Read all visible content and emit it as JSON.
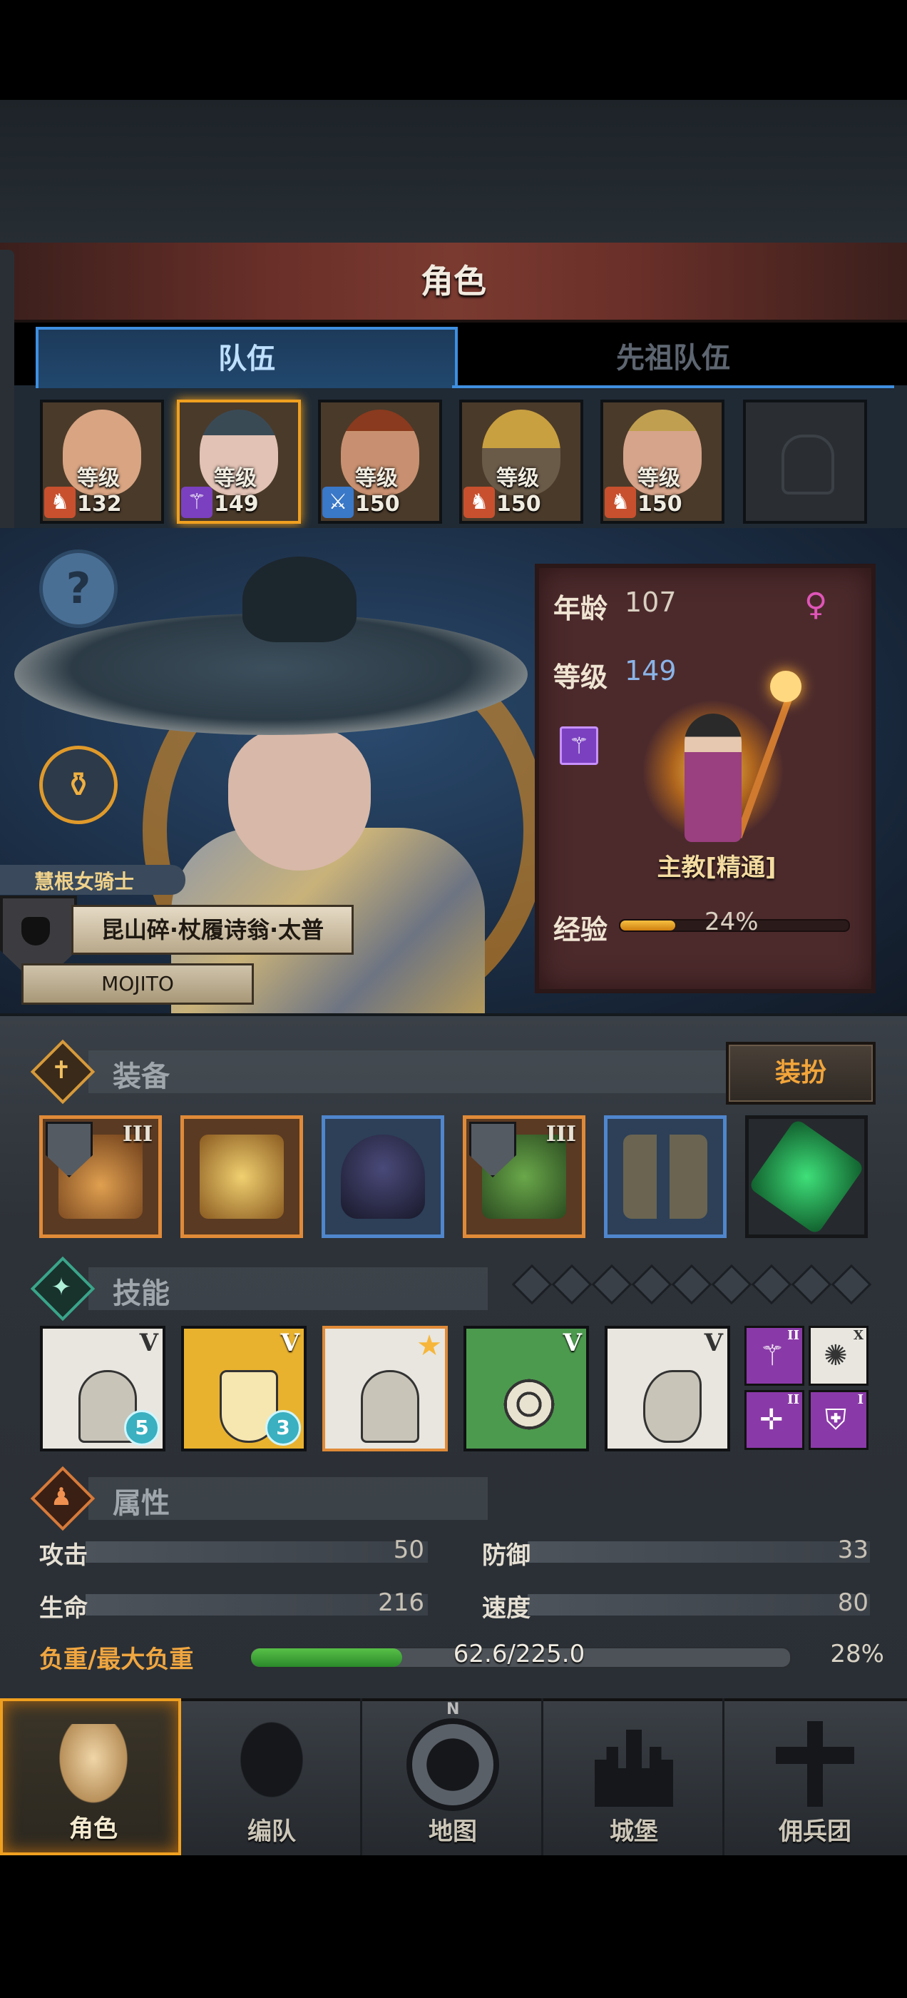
{
  "header": {
    "title": "角色"
  },
  "tabs": [
    {
      "label": "队伍",
      "active": true
    },
    {
      "label": "先祖队伍",
      "active": false
    }
  ],
  "roster": [
    {
      "level_text": "等级132",
      "class_icon": "warrior-red-icon",
      "selected": false
    },
    {
      "level_text": "等级149",
      "class_icon": "staff-purple-icon",
      "selected": true
    },
    {
      "level_text": "等级150",
      "class_icon": "sword-blue-icon",
      "selected": false
    },
    {
      "level_text": "等级150",
      "class_icon": "warrior-red-icon",
      "selected": false
    },
    {
      "level_text": "等级150",
      "class_icon": "warrior-red-icon",
      "selected": false
    },
    {
      "level_text": "",
      "class_icon": "empty-slot-icon",
      "selected": false
    }
  ],
  "hero": {
    "order": "慧根女骑士",
    "title": "昆山碎·杖履诗翁·太普",
    "player": "MOJITO"
  },
  "info": {
    "age_label": "年龄",
    "age_value": "107",
    "level_label": "等级",
    "level_value": "149",
    "class_name": "主教[精通]",
    "exp_label": "经验",
    "exp_percent_text": "24%",
    "exp_fraction": 0.24,
    "gender_icon": "female-icon",
    "gender_glyph": "♀",
    "age_color": "#d9cfc0",
    "level_color": "#8ab4e8"
  },
  "equipment": {
    "title": "装备",
    "dress_button": "装扮",
    "slots": [
      {
        "tier": "III",
        "frame": "orange",
        "shield": true
      },
      {
        "tier": "",
        "frame": "orange",
        "shield": false
      },
      {
        "tier": "",
        "frame": "blue",
        "shield": false
      },
      {
        "tier": "III",
        "frame": "orange",
        "shield": true
      },
      {
        "tier": "",
        "frame": "blue",
        "shield": false
      },
      {
        "tier": "",
        "frame": "dark",
        "shield": false
      }
    ]
  },
  "skills": {
    "title": "技能",
    "slot_dots": 9,
    "items": [
      {
        "rank": "V",
        "badge": "5",
        "bg": "#e8e6df"
      },
      {
        "rank": "V",
        "badge": "3",
        "bg": "#e9b22e"
      },
      {
        "rank": "",
        "badge": "",
        "bg": "#e8e6df",
        "starred": true
      },
      {
        "rank": "V",
        "badge": "",
        "bg": "#4c9a4e"
      },
      {
        "rank": "V",
        "badge": "",
        "bg": "#e8e6df"
      }
    ],
    "passives": [
      {
        "tier": "II",
        "bg": "#8a3aa8"
      },
      {
        "tier": "X",
        "bg": "#e8e6df"
      },
      {
        "tier": "II",
        "bg": "#8a3aa8"
      },
      {
        "tier": "I",
        "bg": "#8a3aa8"
      }
    ]
  },
  "attributes": {
    "title": "属性",
    "stats": [
      {
        "name": "攻击",
        "value": "50"
      },
      {
        "name": "防御",
        "value": "33"
      },
      {
        "name": "生命",
        "value": "216"
      },
      {
        "name": "速度",
        "value": "80"
      }
    ],
    "load_label": "负重/最大负重",
    "load_text": "62.6/225.0",
    "load_percent_text": "28%",
    "load_fraction": 0.28
  },
  "nav": [
    {
      "label": "角色",
      "icon": "knight-icon",
      "active": true
    },
    {
      "label": "编队",
      "icon": "helmet-icon",
      "active": false
    },
    {
      "label": "地图",
      "icon": "compass-map-icon",
      "active": false
    },
    {
      "label": "城堡",
      "icon": "castle-icon",
      "active": false
    },
    {
      "label": "佣兵团",
      "icon": "mercenary-banner-icon",
      "active": false
    }
  ],
  "compass_letter": "N"
}
